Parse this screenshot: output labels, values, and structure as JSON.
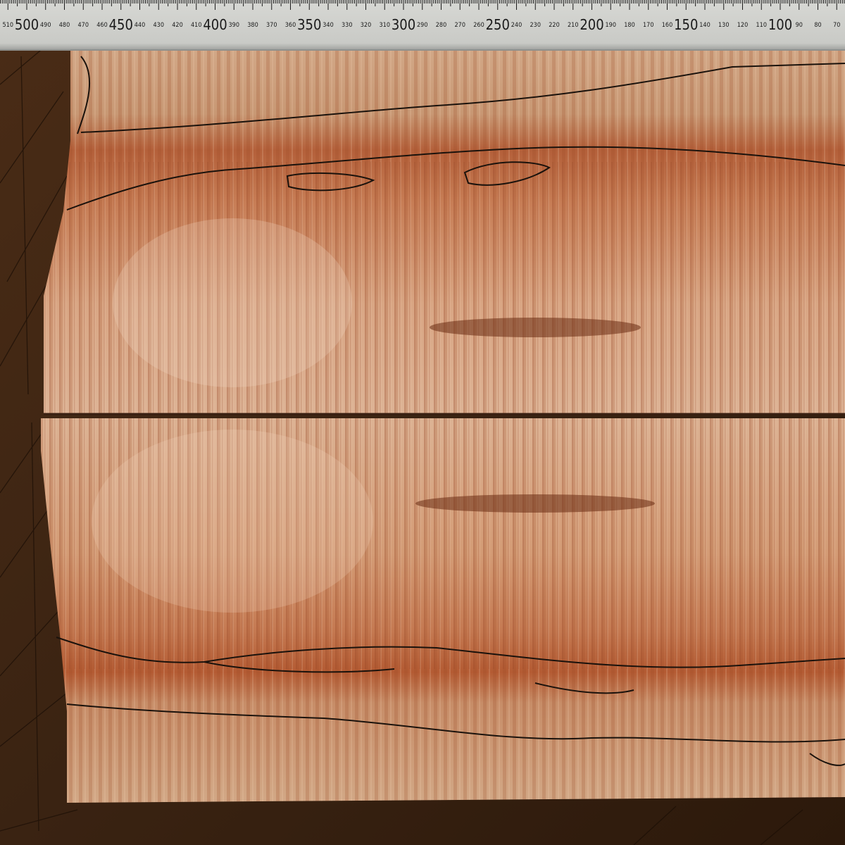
{
  "image": {
    "subject": "Two bookmatched boards of figured, spalted maple on a dark wooden workbench, with a metal ruler along the top edge",
    "colors": {
      "bench": "#3b2413",
      "bench_lines": "#1c0f06",
      "wood_light": "#d9b08e",
      "wood_mid": "#c98a62",
      "wood_dark": "#b8663f",
      "wood_band": "#b05a34",
      "spalt_line": "#1a120c",
      "ruler_face": "#cfd0cc",
      "ruler_edge": "#8f918e",
      "ruler_text": "#1a1a1a"
    },
    "ruler": {
      "major_labels": [
        "500",
        "450",
        "400",
        "350",
        "300",
        "250",
        "200",
        "150",
        "100"
      ],
      "minor_labels": [
        "510",
        "490",
        "480",
        "470",
        "460",
        "440",
        "430",
        "420",
        "410",
        "390",
        "380",
        "370",
        "360",
        "340",
        "330",
        "320",
        "310",
        "290",
        "280",
        "270",
        "260",
        "240",
        "230",
        "220",
        "210",
        "190",
        "180",
        "170",
        "160",
        "140",
        "130",
        "120",
        "110",
        "90",
        "80",
        "70"
      ],
      "unit_hint": "mm"
    }
  }
}
